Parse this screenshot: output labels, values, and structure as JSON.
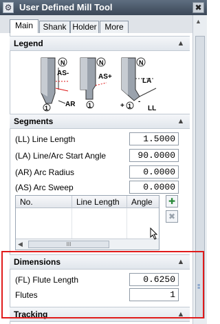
{
  "window": {
    "title": "User Defined Mill Tool",
    "gear_icon": "gear-icon",
    "close_glyph": "✖"
  },
  "tabs": [
    {
      "label": "Main",
      "active": true
    },
    {
      "label": "Shank",
      "active": false
    },
    {
      "label": "Holder",
      "active": false
    },
    {
      "label": "More",
      "active": false
    }
  ],
  "legend": {
    "title": "Legend",
    "labels": {
      "N1": "N",
      "N2": "N",
      "N3": "N",
      "as1": "AS-",
      "ar": "AR",
      "one1": "1",
      "as2": "AS+",
      "one2": "1",
      "la": "LA",
      "ll": "LL",
      "plus": "+",
      "one3": "1",
      "minus": "-"
    }
  },
  "segments": {
    "title": "Segments",
    "rows": [
      {
        "label": "(LL) Line Length",
        "value": "1.5000"
      },
      {
        "label": "(LA) Line/Arc Start Angle",
        "value": "90.0000"
      },
      {
        "label": "(AR) Arc Radius",
        "value": "0.0000"
      },
      {
        "label": "(AS) Arc Sweep",
        "value": "0.0000"
      }
    ],
    "table_headers": [
      "No.",
      "Line Length",
      "Angle"
    ],
    "scroll_thumb": "III"
  },
  "dimensions": {
    "title": "Dimensions",
    "flute_length_label": "(FL) Flute Length",
    "flute_length_value": "0.6250",
    "flutes_label": "Flutes",
    "flutes_value": "1"
  },
  "tracking": {
    "title": "Tracking"
  },
  "colors": {
    "highlight": "#e01a1a",
    "accent": "#4a78b8"
  }
}
